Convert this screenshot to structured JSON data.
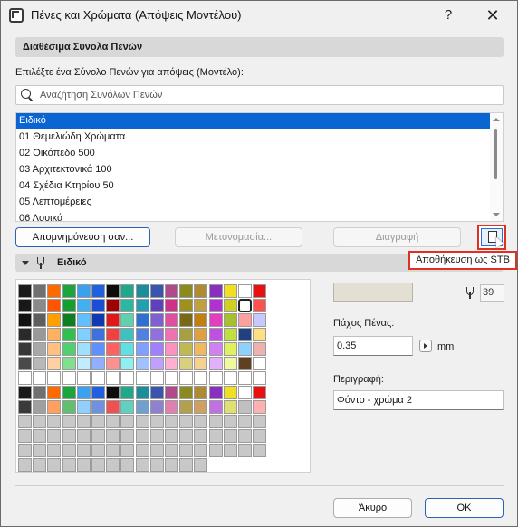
{
  "window": {
    "title": "Πένες και Χρώματα (Απόψεις Μοντέλου)",
    "help_label": "?",
    "close_label": "✕"
  },
  "available_sets": {
    "header": "Διαθέσιμα Σύνολα Πενών",
    "choose_label": "Επιλέξτε ένα Σύνολο Πενών για απόψεις (Μοντέλο):",
    "search_placeholder": "Αναζήτηση Συνόλων Πενών",
    "items": [
      "Ειδικό",
      "01 Θεμελιώδη Χρώματα",
      "02 Οικόπεδο 500",
      "03 Αρχιτεκτονικά 100",
      "04 Σχέδια Κτηρίου 50",
      "05 Λεπτομέρειες",
      "06 Λουικά"
    ],
    "selected_index": 0
  },
  "actions": {
    "store": "Απομνημόνευση σαν...",
    "rename": "Μετονομασία...",
    "delete": "Διαγραφή",
    "save_stb_tooltip": "Αποθήκευση ως STB"
  },
  "pen_panel": {
    "title": "Ειδικό",
    "pen_number": "39",
    "pen_color": "#e3dfd3",
    "pen_weight_label": "Πάχος Πένας:",
    "pen_weight_value": "0.35",
    "pen_weight_unit": "mm",
    "description_label": "Περιγραφή:",
    "description_value": "Φόντο - χρώμα 2"
  },
  "palette_rows": [
    [
      "#1a1a1a",
      "#707070",
      "#ff6a00",
      "#1aa63c",
      "#3aa0f0",
      "#2060e0",
      "#0d0d0d",
      "#1fa88a",
      "#1c8d9a",
      "#3a55b0",
      "#b04a8a",
      "#8a8a20",
      "#b08a30",
      "#8a30c0",
      "#f0e020",
      "#ffffff",
      "#e81010"
    ],
    [
      "#181818",
      "#8a8a8a",
      "#ff5500",
      "#14a030",
      "#40b0f0",
      "#1a4ed8",
      "#a00000",
      "#2ab8a0",
      "#20a0b0",
      "#6040c0",
      "#d0308a",
      "#a09020",
      "#c0a040",
      "#b030d0",
      "#d0d020",
      "#ffffff",
      "#ff5050"
    ],
    [
      "#121212",
      "#5e5e5e",
      "#ffa000",
      "#0c8020",
      "#60c0ff",
      "#1038b0",
      "#e01818",
      "#60d0b0",
      "#3070d0",
      "#8060d0",
      "#e050a0",
      "#786818",
      "#c08010",
      "#e040c0",
      "#a8c030",
      "#ffa0a0",
      "#c8c8ff"
    ],
    [
      "#2a2a2a",
      "#989898",
      "#ffb060",
      "#30c050",
      "#80d0ff",
      "#4070e0",
      "#f04040",
      "#40c0c0",
      "#5080e0",
      "#9070e0",
      "#f070b0",
      "#a8a040",
      "#e0a040",
      "#c050e0",
      "#c0e040",
      "#204080",
      "#ffe080"
    ],
    [
      "#383838",
      "#a8a8a8",
      "#ffc080",
      "#50d070",
      "#a0e0ff",
      "#6090ff",
      "#ff6060",
      "#60e0e0",
      "#80a0ff",
      "#a080ff",
      "#ff90c0",
      "#c0b850",
      "#f0b860",
      "#d080f0",
      "#e0f060",
      "#90d0ff",
      "#f0b0b0"
    ],
    [
      "#4a4a4a",
      "#b8b8b8",
      "#ffd0a0",
      "#80e090",
      "#c0ecff",
      "#90b0ff",
      "#ff9090",
      "#90f0f0",
      "#a0c0ff",
      "#c0a0ff",
      "#ffb0d0",
      "#d8d080",
      "#f8d090",
      "#e0b0f8",
      "#f0f8a0",
      "#604020",
      "#ffffff"
    ],
    [
      "#ffffff",
      "#ffffff",
      "#ffffff",
      "#ffffff",
      "#ffffff",
      "#ffffff",
      "#ffffff",
      "#ffffff",
      "#ffffff",
      "#ffffff",
      "#ffffff",
      "#ffffff",
      "#ffffff",
      "#ffffff",
      "#ffffff",
      "#ffffff",
      "#ffffff"
    ],
    [
      "#1a1a1a",
      "#707070",
      "#ff6a00",
      "#1aa63c",
      "#3aa0f0",
      "#2060e0",
      "#0d0d0d",
      "#1fa88a",
      "#1c8d9a",
      "#3a55b0",
      "#b04a8a",
      "#8a8a20",
      "#b08a30",
      "#8a30c0",
      "#f0e020",
      "#ffffff",
      "#e81010"
    ],
    [
      "#3a3a3a",
      "#a0a0a0",
      "#ffa060",
      "#60c070",
      "#90d0ff",
      "#7090e0",
      "#f05050",
      "#60d0c0",
      "#70a0d0",
      "#9080d0",
      "#e080b0",
      "#b0a050",
      "#d0a060",
      "#c070e0",
      "#e0e070",
      "#c0c0c0",
      "#ffb0b0"
    ],
    [
      "#c8c8c8",
      "#c8c8c8",
      "#c8c8c8",
      "#c8c8c8",
      "#c8c8c8",
      "#c8c8c8",
      "#c8c8c8",
      "#c8c8c8",
      "#c8c8c8",
      "#c8c8c8",
      "#c8c8c8",
      "#c8c8c8",
      "#c8c8c8",
      "#c8c8c8",
      "#c8c8c8",
      "#c8c8c8",
      "#c8c8c8"
    ],
    [
      "#c8c8c8",
      "#c8c8c8",
      "#c8c8c8",
      "#c8c8c8",
      "#c8c8c8",
      "#c8c8c8",
      "#c8c8c8",
      "#c8c8c8",
      "#c8c8c8",
      "#c8c8c8",
      "#c8c8c8",
      "#c8c8c8",
      "#c8c8c8",
      "#c8c8c8",
      "#c8c8c8",
      "#c8c8c8",
      "#c8c8c8"
    ],
    [
      "#c8c8c8",
      "#c8c8c8",
      "#c8c8c8",
      "#c8c8c8",
      "#c8c8c8",
      "#c8c8c8",
      "#c8c8c8",
      "#c8c8c8",
      "#c8c8c8",
      "#c8c8c8",
      "#c8c8c8",
      "#c8c8c8",
      "#c8c8c8",
      "#c8c8c8",
      "#c8c8c8",
      "#c8c8c8",
      "#c8c8c8"
    ],
    [
      "#c8c8c8",
      "#c8c8c8",
      "#c8c8c8",
      "#c8c8c8",
      "#c8c8c8",
      "#c8c8c8",
      "#c8c8c8",
      "#c8c8c8",
      "#c8c8c8",
      "#c8c8c8",
      "#c8c8c8",
      "#c8c8c8",
      "#c8c8c8"
    ]
  ],
  "footer": {
    "cancel": "Άκυρο",
    "ok": "OK"
  }
}
